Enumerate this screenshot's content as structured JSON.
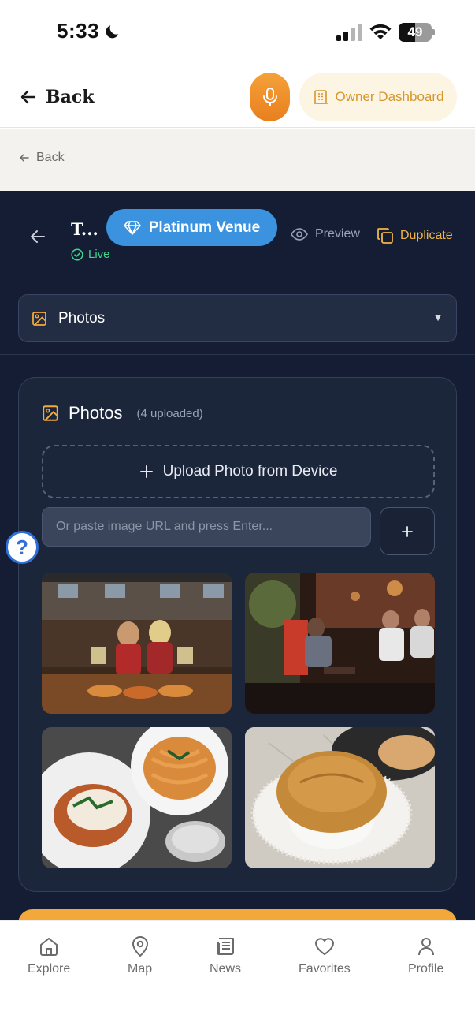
{
  "status_bar": {
    "time": "5:33",
    "battery": "49",
    "battery_level": 0.49
  },
  "header": {
    "back_label": "Back",
    "owner_dashboard_label": "Owner Dashboard"
  },
  "subheader": {
    "back_label": "Back"
  },
  "venue": {
    "title": "T...",
    "status": "Live",
    "badge": "Platinum Venue",
    "preview_label": "Preview",
    "duplicate_label": "Duplicate"
  },
  "section_select": {
    "selected": "Photos"
  },
  "photos": {
    "title": "Photos",
    "count_text": "(4 uploaded)",
    "upload_label": "Upload Photo from Device",
    "url_placeholder": "Or paste image URL and press Enter...",
    "add_button_symbol": "+",
    "items": [
      "photo-1",
      "photo-2",
      "photo-3",
      "photo-4"
    ]
  },
  "help": {
    "symbol": "?"
  },
  "nav": {
    "items": [
      {
        "label": "Explore",
        "icon": "home-icon"
      },
      {
        "label": "Map",
        "icon": "map-pin-icon"
      },
      {
        "label": "News",
        "icon": "newspaper-icon"
      },
      {
        "label": "Favorites",
        "icon": "heart-icon"
      },
      {
        "label": "Profile",
        "icon": "user-icon"
      }
    ]
  },
  "colors": {
    "accent_orange": "#f2a93a",
    "platinum_blue": "#3b93e0",
    "live_green": "#3dd68c",
    "duplicate_gold": "#f2b544",
    "editor_bg": "#141d33"
  }
}
